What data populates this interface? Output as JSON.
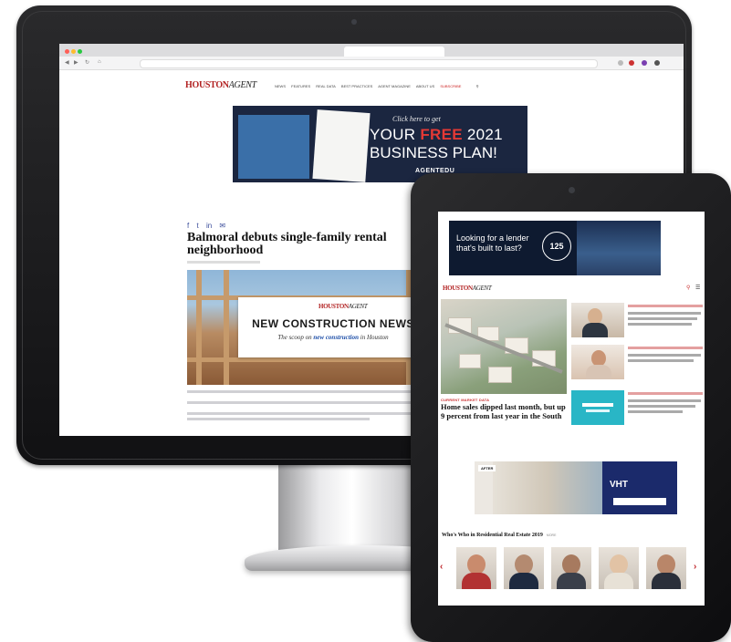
{
  "desktop": {
    "nav": {
      "logo_main": "HOUSTON",
      "logo_sub": "AGENT",
      "items": [
        "NEWS",
        "FEATURES",
        "REAL DATA",
        "BEST PRACTICES",
        "AGENT MAGAZINE",
        "ABOUT US"
      ],
      "highlight_item": "SUBSCRIBE"
    },
    "banner_ad": {
      "line1": "Click here to get",
      "line2_prefix": "YOUR ",
      "line2_highlight": "FREE",
      "line2_suffix": " 2021",
      "line3": "BUSINESS PLAN!",
      "brand": "AGENTEDU"
    },
    "article": {
      "title": "Balmoral debuts single-family rental neighborhood",
      "hero_card": {
        "logo_main": "HOUSTON",
        "logo_sub": "AGENT",
        "title": "NEW CONSTRUCTION NEWS",
        "sub_prefix": "The scoop on ",
        "sub_highlight": "new construction",
        "sub_suffix": " in Houston"
      }
    },
    "icons": {
      "share": [
        "facebook-icon",
        "twitter-icon",
        "linkedin-icon",
        "email-icon"
      ]
    }
  },
  "tablet": {
    "ad_top": {
      "text": "Looking for a lender that's built to last?",
      "badge": "125"
    },
    "logo_main": "HOUSTON",
    "logo_sub": "AGENT",
    "main_story": {
      "kicker": "CURRENT MARKET DATA",
      "headline": "Home sales dipped last month, but up 9 percent from last year in the South"
    },
    "ad_vht": {
      "badge": "AFTER",
      "brand": "VHT"
    },
    "whos_who": {
      "title": "Who's Who in Residential Real Estate 2019",
      "more": "MORE"
    }
  },
  "colors": {
    "brand_red": "#b22222",
    "ad_navy": "#1b2640",
    "vht_blue": "#1b2a6b"
  }
}
